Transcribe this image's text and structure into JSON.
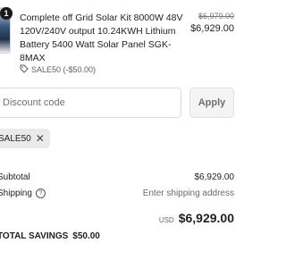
{
  "product": {
    "quantity": "1",
    "title": "Complete off Grid Solar Kit 8000W 48V 120V/240V output 10.24KWH Lithium Battery 5400 Watt Solar Panel SGK-8MAX",
    "original_price": "$6,979.00",
    "price": "$6,929.00",
    "discount_label": "SALE50 (-$50.00)",
    "discount_icon": "tag-icon"
  },
  "discount": {
    "placeholder": "Discount code",
    "apply_label": "Apply",
    "applied_code": "SALE50"
  },
  "totals": {
    "subtotal_label": "Subtotal",
    "subtotal_value": "$6,929.00",
    "shipping_label": "Shipping",
    "shipping_value": "Enter shipping address",
    "currency": "USD",
    "total_value": "$6,929.00",
    "savings_label": "TOTAL SAVINGS",
    "savings_value": "$50.00"
  }
}
